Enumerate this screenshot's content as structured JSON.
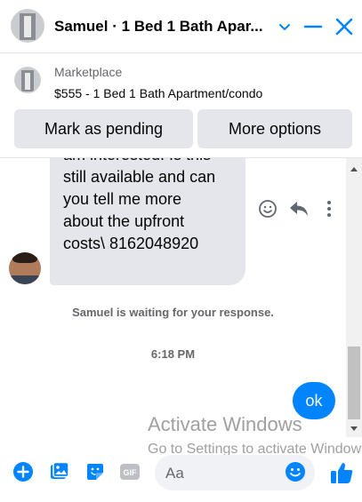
{
  "header": {
    "title": "Samuel · 1 Bed 1 Bath Apar...",
    "chevron_icon": "chevron-down-icon",
    "minimize_icon": "minimize-icon",
    "close_icon": "close-icon",
    "accent": "#0084ff"
  },
  "marketplace": {
    "label": "Marketplace",
    "listing": "$555 - 1 Bed 1 Bath Apartment/condo",
    "buttons": {
      "pending": "Mark as pending",
      "more": "More options"
    }
  },
  "chat": {
    "message_lines": [
      "am interested. Is this",
      "still available and can",
      "you tell me more",
      "about the upfront",
      "costs\\ 8162048920"
    ],
    "message_actions": [
      "emoji-icon",
      "reply-icon",
      "more-vertical-icon"
    ],
    "waiting_text": "Samuel is waiting for your response.",
    "timestamp": "6:18 PM",
    "sent_message": "ok"
  },
  "watermark": {
    "line1": "Activate Windows",
    "line2": "Go to Settings to activate Windows."
  },
  "composer": {
    "placeholder": "Aa",
    "icons": [
      "plus-circle-icon",
      "image-icon",
      "sticker-icon",
      "gif-icon",
      "emoji-icon",
      "thumbs-up-icon"
    ]
  },
  "colors": {
    "accent": "#0084ff",
    "bubble_gray": "#e4e6eb",
    "secondary_text": "#65676b"
  }
}
